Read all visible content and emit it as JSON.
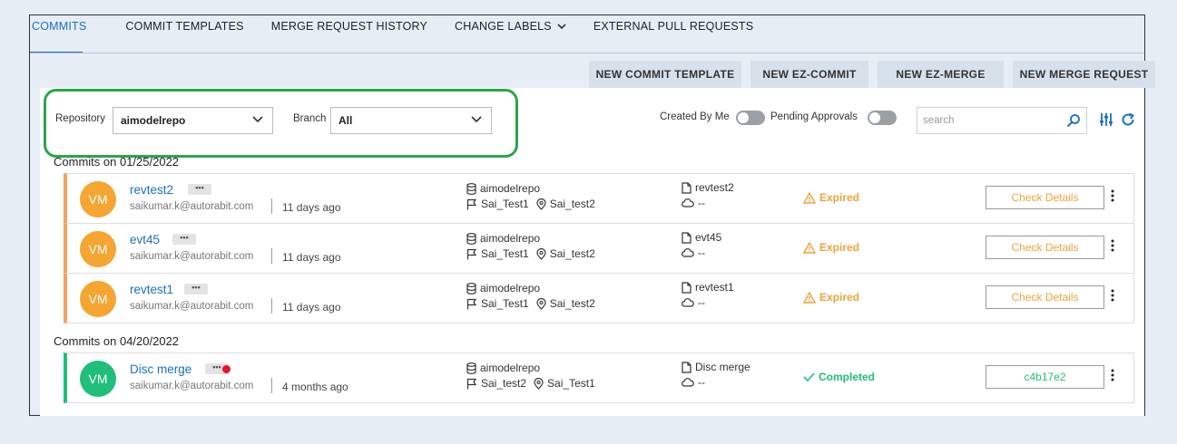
{
  "tabs": [
    {
      "label": "COMMITS"
    },
    {
      "label": "COMMIT TEMPLATES"
    },
    {
      "label": "MERGE REQUEST HISTORY"
    },
    {
      "label": "CHANGE LABELS"
    },
    {
      "label": "EXTERNAL PULL REQUESTS"
    }
  ],
  "actions": [
    {
      "label": "NEW COMMIT TEMPLATE"
    },
    {
      "label": "NEW EZ-COMMIT"
    },
    {
      "label": "NEW EZ-MERGE"
    },
    {
      "label": "NEW MERGE REQUEST"
    }
  ],
  "filters": {
    "repository_label": "Repository",
    "repository_value": "aimodelrepo",
    "branch_label": "Branch",
    "branch_value": "All",
    "created_by_me": "Created By Me",
    "pending_approvals": "Pending Approvals",
    "search_placeholder": "search"
  },
  "groups": [
    {
      "label": "Commits on 01/25/2022",
      "commits": [
        {
          "initials": "VM",
          "name": "revtest2",
          "dots": "•••",
          "email": "saikumar.k@autorabit.com",
          "ago": "11 days ago",
          "repo": "aimodelrepo",
          "source": "Sai_Test1",
          "target": "Sai_test2",
          "file": "revtest2",
          "cloud": "--",
          "status": "Expired",
          "button": "Check Details"
        },
        {
          "initials": "VM",
          "name": "evt45",
          "dots": "•••",
          "email": "saikumar.k@autorabit.com",
          "ago": "11 days ago",
          "repo": "aimodelrepo",
          "source": "Sai_Test1",
          "target": "Sai_test2",
          "file": "evt45",
          "cloud": "--",
          "status": "Expired",
          "button": "Check Details"
        },
        {
          "initials": "VM",
          "name": "revtest1",
          "dots": "•••",
          "email": "saikumar.k@autorabit.com",
          "ago": "11 days ago",
          "repo": "aimodelrepo",
          "source": "Sai_Test1",
          "target": "Sai_test2",
          "file": "revtest1",
          "cloud": "--",
          "status": "Expired",
          "button": "Check Details"
        }
      ]
    },
    {
      "label": "Commits on 04/20/2022",
      "commits": [
        {
          "initials": "VM",
          "name": "Disc merge",
          "dots": "•••",
          "email": "saikumar.k@autorabit.com",
          "ago": "4 months ago",
          "repo": "aimodelrepo",
          "source": "Sai_test2",
          "target": "Sai_Test1",
          "file": "Disc merge",
          "cloud": "--",
          "status": "Completed",
          "button": "c4b17e2"
        }
      ]
    }
  ],
  "colors": {
    "accent": "#1a6fc4",
    "expired": "#f0a33a",
    "completed": "#1fbf7a",
    "highlight": "#2ca54b"
  }
}
